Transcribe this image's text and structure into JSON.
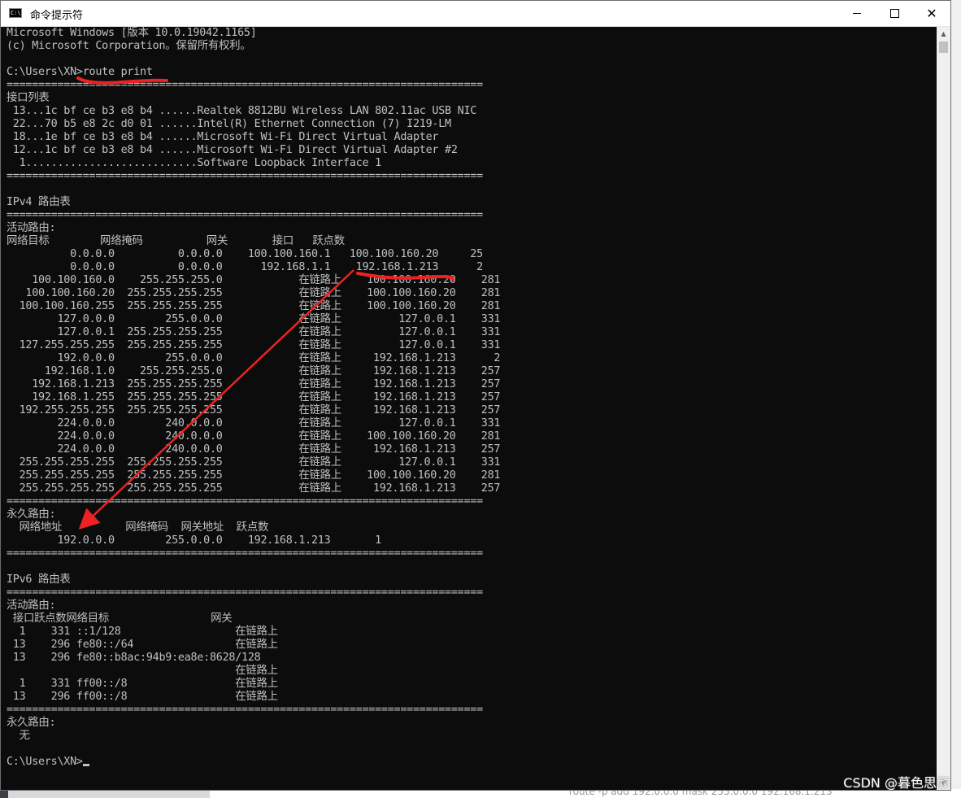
{
  "window": {
    "title": "命令提示符",
    "icon_label": "C:\\"
  },
  "controls": {
    "minimize": "minimize",
    "maximize": "maximize",
    "close": "✕"
  },
  "console": {
    "text": "Microsoft Windows [版本 10.0.19042.1165]\n(c) Microsoft Corporation。保留所有权利。\n\nC:\\Users\\XN>route print\n===========================================================================\n接口列表\n 13...1c bf ce b3 e8 b4 ......Realtek 8812BU Wireless LAN 802.11ac USB NIC\n 22...70 b5 e8 2c d0 01 ......Intel(R) Ethernet Connection (7) I219-LM\n 18...1e bf ce b3 e8 b4 ......Microsoft Wi-Fi Direct Virtual Adapter\n 12...1c bf ce b3 e8 b4 ......Microsoft Wi-Fi Direct Virtual Adapter #2\n  1...........................Software Loopback Interface 1\n===========================================================================\n\nIPv4 路由表\n===========================================================================\n活动路由:\n网络目标        网络掩码          网关       接口   跃点数\n          0.0.0.0          0.0.0.0    100.100.160.1   100.100.160.20     25\n          0.0.0.0          0.0.0.0      192.168.1.1    192.168.1.213      2\n    100.100.160.0    255.255.255.0            在链路上    100.100.160.20    281\n   100.100.160.20  255.255.255.255            在链路上    100.100.160.20    281\n  100.100.160.255  255.255.255.255            在链路上    100.100.160.20    281\n        127.0.0.0        255.0.0.0            在链路上         127.0.0.1    331\n        127.0.0.1  255.255.255.255            在链路上         127.0.0.1    331\n  127.255.255.255  255.255.255.255            在链路上         127.0.0.1    331\n        192.0.0.0        255.0.0.0            在链路上     192.168.1.213      2\n      192.168.1.0    255.255.255.0            在链路上     192.168.1.213    257\n    192.168.1.213  255.255.255.255            在链路上     192.168.1.213    257\n    192.168.1.255  255.255.255.255            在链路上     192.168.1.213    257\n  192.255.255.255  255.255.255.255            在链路上     192.168.1.213    257\n        224.0.0.0        240.0.0.0            在链路上         127.0.0.1    331\n        224.0.0.0        240.0.0.0            在链路上    100.100.160.20    281\n        224.0.0.0        240.0.0.0            在链路上     192.168.1.213    257\n  255.255.255.255  255.255.255.255            在链路上         127.0.0.1    331\n  255.255.255.255  255.255.255.255            在链路上    100.100.160.20    281\n  255.255.255.255  255.255.255.255            在链路上     192.168.1.213    257\n===========================================================================\n永久路由:\n  网络地址          网络掩码  网关地址  跃点数\n        192.0.0.0        255.0.0.0    192.168.1.213       1\n===========================================================================\n\nIPv6 路由表\n===========================================================================\n活动路由:\n 接口跃点数网络目标                网关\n  1    331 ::1/128                  在链路上\n 13    296 fe80::/64                在链路上\n 13    296 fe80::b8ac:94b9:ea8e:8628/128\n                                    在链路上\n  1    331 ff00::/8                 在链路上\n 13    296 ff00::/8                 在链路上\n===========================================================================\n永久路由:\n  无\n\nC:\\Users\\XN>"
  },
  "annotations": {
    "mark_color": "#ee2222"
  },
  "watermark": "CSDN @暮色思颜",
  "background": {
    "bottom_text": "route -p add 192.0.0.0 mask 255.0.0.0 192.168.1.213"
  }
}
